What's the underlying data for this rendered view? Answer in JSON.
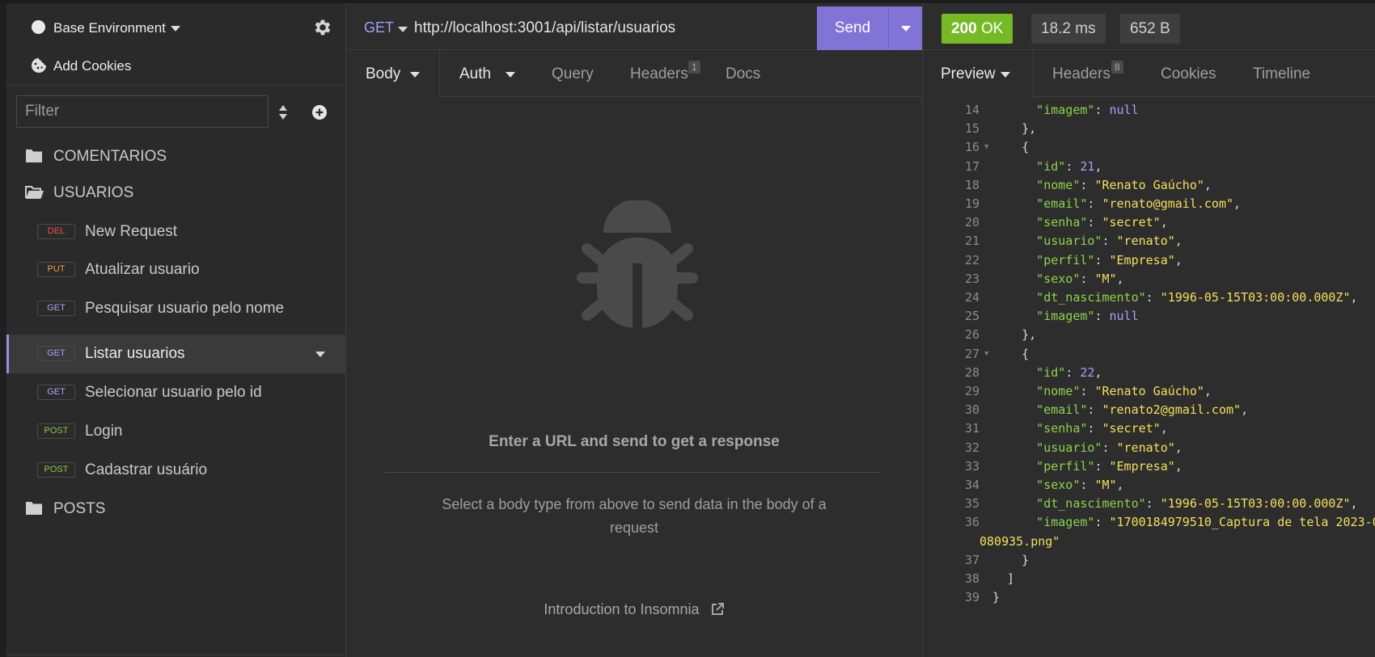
{
  "sidebar": {
    "environment": "Base Environment",
    "cookies": "Add Cookies",
    "filter_placeholder": "Filter",
    "folders": {
      "comentarios": "COMENTARIOS",
      "usuarios": "USUARIOS",
      "posts": "POSTS"
    },
    "requests": [
      {
        "method": "DEL",
        "label": "New Request"
      },
      {
        "method": "PUT",
        "label": "Atualizar usuario"
      },
      {
        "method": "GET",
        "label": "Pesquisar usuario pelo nome"
      },
      {
        "method": "GET",
        "label": "Listar usuarios"
      },
      {
        "method": "GET",
        "label": "Selecionar usuario pelo id"
      },
      {
        "method": "POST",
        "label": "Login"
      },
      {
        "method": "POST",
        "label": "Cadastrar usuário"
      }
    ]
  },
  "request": {
    "method": "GET",
    "url": "http://localhost:3001/api/listar/usuarios",
    "send_label": "Send",
    "tabs": {
      "body": "Body",
      "auth": "Auth",
      "query": "Query",
      "headers": "Headers",
      "headers_count": "1",
      "docs": "Docs"
    },
    "empty_title": "Enter a URL and send to get a response",
    "empty_desc": "Select a body type from above to send data in the body of a request",
    "intro_link": "Introduction to Insomnia"
  },
  "response": {
    "status_code": "200",
    "status_text": "OK",
    "time": "18.2 ms",
    "size": "652 B",
    "tabs": {
      "preview": "Preview",
      "headers": "Headers",
      "headers_count": "8",
      "cookies": "Cookies",
      "timeline": "Timeline"
    },
    "code_lines": [
      {
        "n": "14",
        "fold": "",
        "parts": [
          [
            "p",
            "      "
          ],
          [
            "k",
            "\"imagem\""
          ],
          [
            "p",
            ": "
          ],
          [
            "nl",
            "null"
          ]
        ]
      },
      {
        "n": "15",
        "fold": "",
        "parts": [
          [
            "p",
            "    },"
          ]
        ]
      },
      {
        "n": "16",
        "fold": "▼",
        "parts": [
          [
            "p",
            "    {"
          ]
        ]
      },
      {
        "n": "17",
        "fold": "",
        "parts": [
          [
            "p",
            "      "
          ],
          [
            "k",
            "\"id\""
          ],
          [
            "p",
            ": "
          ],
          [
            "n",
            "21"
          ],
          [
            "p",
            ","
          ]
        ]
      },
      {
        "n": "18",
        "fold": "",
        "parts": [
          [
            "p",
            "      "
          ],
          [
            "k",
            "\"nome\""
          ],
          [
            "p",
            ": "
          ],
          [
            "s",
            "\"Renato Gaúcho\""
          ],
          [
            "p",
            ","
          ]
        ]
      },
      {
        "n": "19",
        "fold": "",
        "parts": [
          [
            "p",
            "      "
          ],
          [
            "k",
            "\"email\""
          ],
          [
            "p",
            ": "
          ],
          [
            "s",
            "\"renato@gmail.com\""
          ],
          [
            "p",
            ","
          ]
        ]
      },
      {
        "n": "20",
        "fold": "",
        "parts": [
          [
            "p",
            "      "
          ],
          [
            "k",
            "\"senha\""
          ],
          [
            "p",
            ": "
          ],
          [
            "s",
            "\"secret\""
          ],
          [
            "p",
            ","
          ]
        ]
      },
      {
        "n": "21",
        "fold": "",
        "parts": [
          [
            "p",
            "      "
          ],
          [
            "k",
            "\"usuario\""
          ],
          [
            "p",
            ": "
          ],
          [
            "s",
            "\"renato\""
          ],
          [
            "p",
            ","
          ]
        ]
      },
      {
        "n": "22",
        "fold": "",
        "parts": [
          [
            "p",
            "      "
          ],
          [
            "k",
            "\"perfil\""
          ],
          [
            "p",
            ": "
          ],
          [
            "s",
            "\"Empresa\""
          ],
          [
            "p",
            ","
          ]
        ]
      },
      {
        "n": "23",
        "fold": "",
        "parts": [
          [
            "p",
            "      "
          ],
          [
            "k",
            "\"sexo\""
          ],
          [
            "p",
            ": "
          ],
          [
            "s",
            "\"M\""
          ],
          [
            "p",
            ","
          ]
        ]
      },
      {
        "n": "24",
        "fold": "",
        "parts": [
          [
            "p",
            "      "
          ],
          [
            "k",
            "\"dt_nascimento\""
          ],
          [
            "p",
            ": "
          ],
          [
            "s",
            "\"1996-05-15T03:00:00.000Z\""
          ],
          [
            "p",
            ","
          ]
        ]
      },
      {
        "n": "25",
        "fold": "",
        "parts": [
          [
            "p",
            "      "
          ],
          [
            "k",
            "\"imagem\""
          ],
          [
            "p",
            ": "
          ],
          [
            "nl",
            "null"
          ]
        ]
      },
      {
        "n": "26",
        "fold": "",
        "parts": [
          [
            "p",
            "    },"
          ]
        ]
      },
      {
        "n": "27",
        "fold": "▼",
        "parts": [
          [
            "p",
            "    {"
          ]
        ]
      },
      {
        "n": "28",
        "fold": "",
        "parts": [
          [
            "p",
            "      "
          ],
          [
            "k",
            "\"id\""
          ],
          [
            "p",
            ": "
          ],
          [
            "n",
            "22"
          ],
          [
            "p",
            ","
          ]
        ]
      },
      {
        "n": "29",
        "fold": "",
        "parts": [
          [
            "p",
            "      "
          ],
          [
            "k",
            "\"nome\""
          ],
          [
            "p",
            ": "
          ],
          [
            "s",
            "\"Renato Gaúcho\""
          ],
          [
            "p",
            ","
          ]
        ]
      },
      {
        "n": "30",
        "fold": "",
        "parts": [
          [
            "p",
            "      "
          ],
          [
            "k",
            "\"email\""
          ],
          [
            "p",
            ": "
          ],
          [
            "s",
            "\"renato2@gmail.com\""
          ],
          [
            "p",
            ","
          ]
        ]
      },
      {
        "n": "31",
        "fold": "",
        "parts": [
          [
            "p",
            "      "
          ],
          [
            "k",
            "\"senha\""
          ],
          [
            "p",
            ": "
          ],
          [
            "s",
            "\"secret\""
          ],
          [
            "p",
            ","
          ]
        ]
      },
      {
        "n": "32",
        "fold": "",
        "parts": [
          [
            "p",
            "      "
          ],
          [
            "k",
            "\"usuario\""
          ],
          [
            "p",
            ": "
          ],
          [
            "s",
            "\"renato\""
          ],
          [
            "p",
            ","
          ]
        ]
      },
      {
        "n": "33",
        "fold": "",
        "parts": [
          [
            "p",
            "      "
          ],
          [
            "k",
            "\"perfil\""
          ],
          [
            "p",
            ": "
          ],
          [
            "s",
            "\"Empresa\""
          ],
          [
            "p",
            ","
          ]
        ]
      },
      {
        "n": "34",
        "fold": "",
        "parts": [
          [
            "p",
            "      "
          ],
          [
            "k",
            "\"sexo\""
          ],
          [
            "p",
            ": "
          ],
          [
            "s",
            "\"M\""
          ],
          [
            "p",
            ","
          ]
        ]
      },
      {
        "n": "35",
        "fold": "",
        "parts": [
          [
            "p",
            "      "
          ],
          [
            "k",
            "\"dt_nascimento\""
          ],
          [
            "p",
            ": "
          ],
          [
            "s",
            "\"1996-05-15T03:00:00.000Z\""
          ],
          [
            "p",
            ","
          ]
        ]
      },
      {
        "n": "36",
        "fold": "",
        "parts": [
          [
            "p",
            "      "
          ],
          [
            "k",
            "\"imagem\""
          ],
          [
            "p",
            ": "
          ],
          [
            "s",
            "\"1700184979510_Captura de tela 2023-0"
          ]
        ]
      },
      {
        "n": "",
        "fold": "",
        "parts": [
          [
            "s",
            "080935.png\""
          ]
        ]
      },
      {
        "n": "37",
        "fold": "",
        "parts": [
          [
            "p",
            "    }"
          ]
        ]
      },
      {
        "n": "38",
        "fold": "",
        "parts": [
          [
            "p",
            "  ]"
          ]
        ]
      },
      {
        "n": "39",
        "fold": "",
        "parts": [
          [
            "p",
            "}"
          ]
        ]
      }
    ]
  },
  "colors": {
    "accent": "#8273d6",
    "status_ok": "#75ba24",
    "method_get": "#a89ff5",
    "method_post": "#8ac94d",
    "method_put": "#ee9b42",
    "method_del": "#ee4f4f"
  },
  "icons": [
    "gear-icon",
    "cookie-icon",
    "sort-icon",
    "add-icon",
    "folder-icon",
    "folder-open-icon",
    "bug-icon",
    "external-link-icon"
  ]
}
